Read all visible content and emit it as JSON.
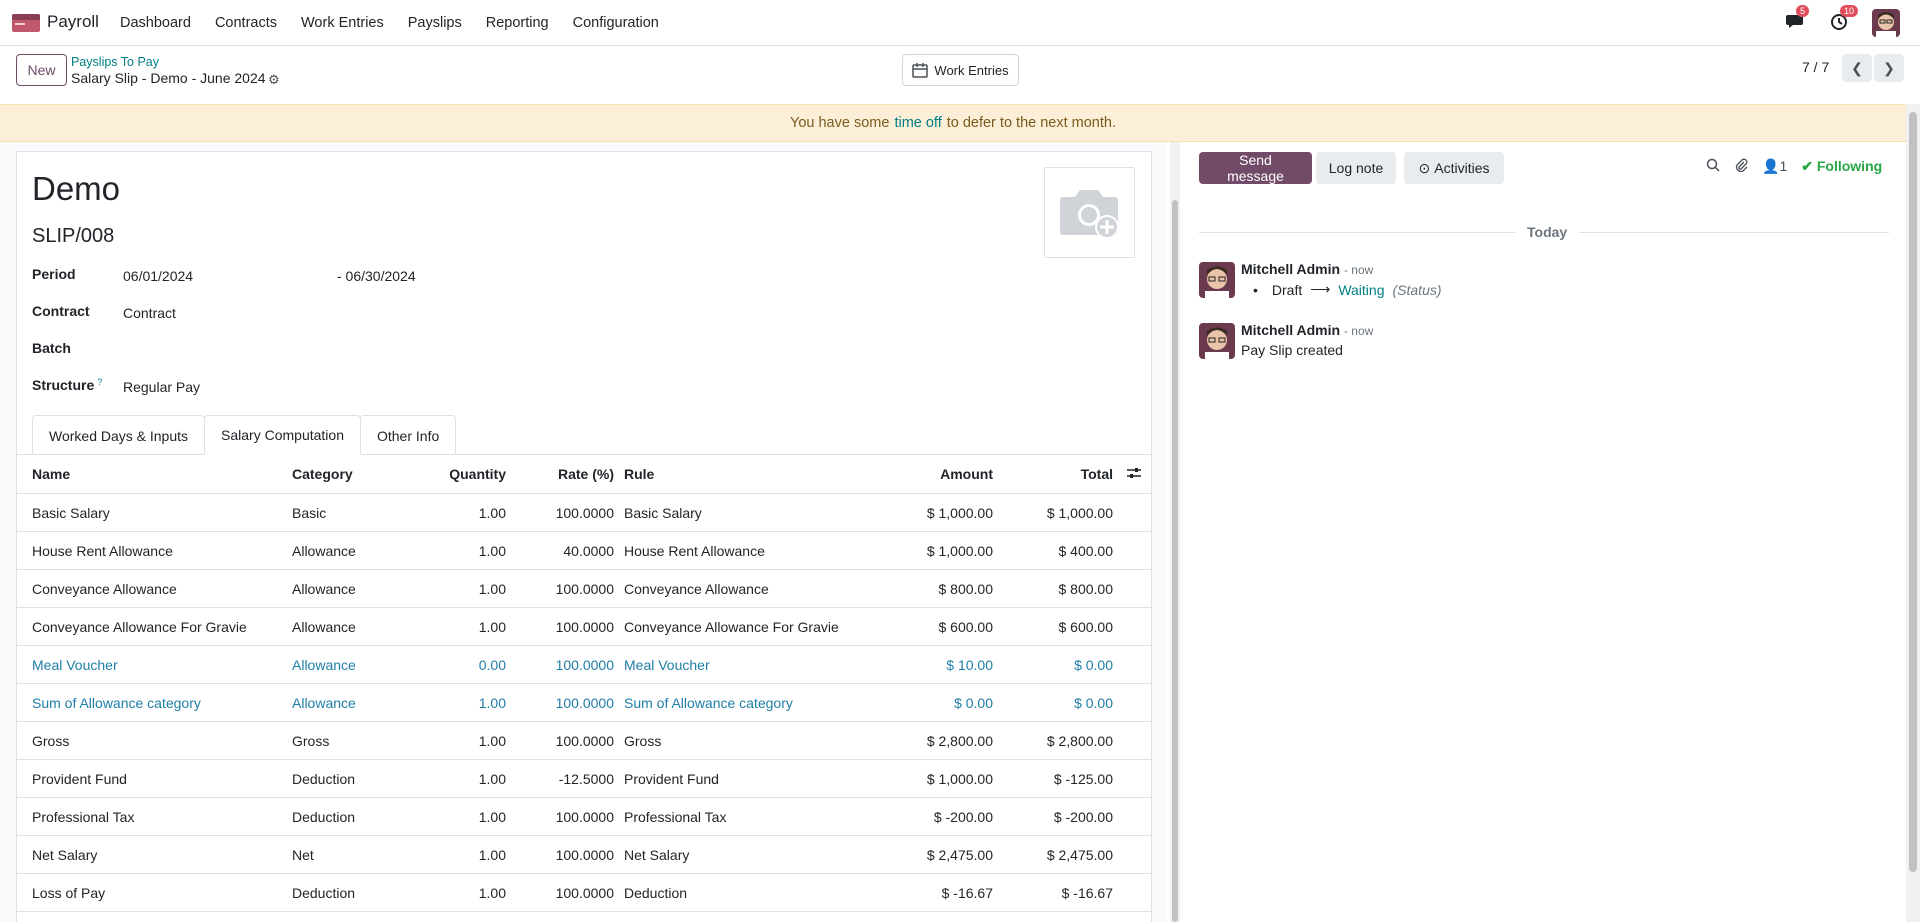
{
  "nav": {
    "app_name": "Payroll",
    "menu": [
      "Dashboard",
      "Contracts",
      "Work Entries",
      "Payslips",
      "Reporting",
      "Configuration"
    ],
    "messages_badge": "5",
    "activities_badge": "10"
  },
  "control": {
    "new_label": "New",
    "breadcrumb_parent": "Payslips To Pay",
    "breadcrumb_current": "Salary Slip - Demo - June 2024",
    "work_entries_label": "Work Entries",
    "pager": "7 / 7"
  },
  "alert": {
    "before": "You have some",
    "link": "time off",
    "after": "to defer to the next month."
  },
  "form": {
    "employee": "Demo",
    "slip_number": "SLIP/008",
    "fields": {
      "period_label": "Period",
      "period_from": "06/01/2024",
      "period_to": "- 06/30/2024",
      "contract_label": "Contract",
      "contract_value": "Contract",
      "batch_label": "Batch",
      "structure_label": "Structure",
      "structure_help": "?",
      "structure_value": "Regular Pay"
    },
    "tabs": [
      "Worked Days & Inputs",
      "Salary Computation",
      "Other Info"
    ],
    "active_tab": "Salary Computation"
  },
  "table": {
    "headers": {
      "name": "Name",
      "category": "Category",
      "quantity": "Quantity",
      "rate": "Rate (%)",
      "rule": "Rule",
      "amount": "Amount",
      "total": "Total"
    },
    "rows": [
      {
        "name": "Basic Salary",
        "category": "Basic",
        "quantity": "1.00",
        "rate": "100.0000",
        "rule": "Basic Salary",
        "amount": "$ 1,000.00",
        "total": "$ 1,000.00",
        "muted": false
      },
      {
        "name": "House Rent Allowance",
        "category": "Allowance",
        "quantity": "1.00",
        "rate": "40.0000",
        "rule": "House Rent Allowance",
        "amount": "$ 1,000.00",
        "total": "$ 400.00",
        "muted": false
      },
      {
        "name": "Conveyance Allowance",
        "category": "Allowance",
        "quantity": "1.00",
        "rate": "100.0000",
        "rule": "Conveyance Allowance",
        "amount": "$ 800.00",
        "total": "$ 800.00",
        "muted": false
      },
      {
        "name": "Conveyance Allowance For Gravie",
        "category": "Allowance",
        "quantity": "1.00",
        "rate": "100.0000",
        "rule": "Conveyance Allowance For Gravie",
        "amount": "$ 600.00",
        "total": "$ 600.00",
        "muted": false
      },
      {
        "name": "Meal Voucher",
        "category": "Allowance",
        "quantity": "0.00",
        "rate": "100.0000",
        "rule": "Meal Voucher",
        "amount": "$ 10.00",
        "total": "$ 0.00",
        "muted": true
      },
      {
        "name": "Sum of Allowance category",
        "category": "Allowance",
        "quantity": "1.00",
        "rate": "100.0000",
        "rule": "Sum of Allowance category",
        "amount": "$ 0.00",
        "total": "$ 0.00",
        "muted": true
      },
      {
        "name": "Gross",
        "category": "Gross",
        "quantity": "1.00",
        "rate": "100.0000",
        "rule": "Gross",
        "amount": "$ 2,800.00",
        "total": "$ 2,800.00",
        "muted": false
      },
      {
        "name": "Provident Fund",
        "category": "Deduction",
        "quantity": "1.00",
        "rate": "-12.5000",
        "rule": "Provident Fund",
        "amount": "$ 1,000.00",
        "total": "$ -125.00",
        "muted": false
      },
      {
        "name": "Professional Tax",
        "category": "Deduction",
        "quantity": "1.00",
        "rate": "100.0000",
        "rule": "Professional Tax",
        "amount": "$ -200.00",
        "total": "$ -200.00",
        "muted": false
      },
      {
        "name": "Net Salary",
        "category": "Net",
        "quantity": "1.00",
        "rate": "100.0000",
        "rule": "Net Salary",
        "amount": "$ 2,475.00",
        "total": "$ 2,475.00",
        "muted": false
      },
      {
        "name": "Loss of Pay",
        "category": "Deduction",
        "quantity": "1.00",
        "rate": "100.0000",
        "rule": "Deduction",
        "amount": "$ -16.67",
        "total": "$ -16.67",
        "muted": false
      }
    ]
  },
  "chatter": {
    "send_message": "Send message",
    "log_note": "Log note",
    "activities": "Activities",
    "followers_count": "1",
    "following": "Following",
    "date_separator": "Today",
    "messages": [
      {
        "author": "Mitchell Admin",
        "time": "- now",
        "old_value": "Draft",
        "new_value": "Waiting",
        "field": "(Status)"
      },
      {
        "author": "Mitchell Admin",
        "time": "- now",
        "body": "Pay Slip created"
      }
    ]
  },
  "colors": {
    "brand": "#714b67",
    "link": "#017e84",
    "muted_row": "#1e7ea7",
    "alert_bg": "#fbefd8",
    "following": "#28a745"
  }
}
